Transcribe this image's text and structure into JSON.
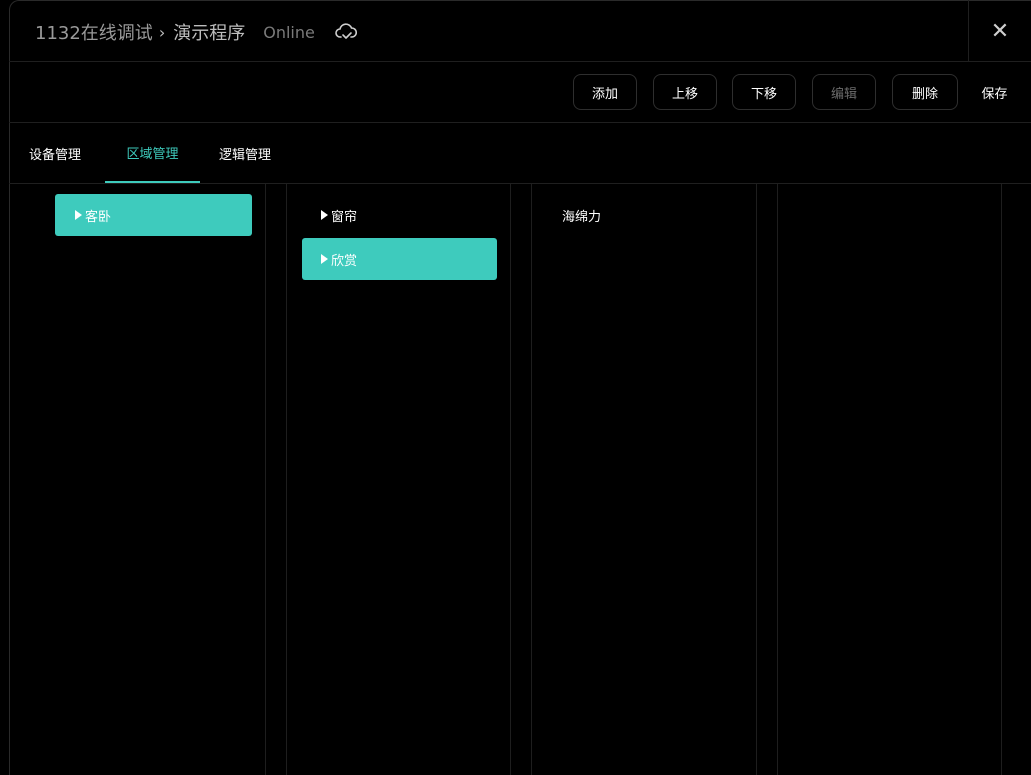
{
  "header": {
    "project": "1132在线调试",
    "page": "演示程序",
    "status": "Online"
  },
  "toolbar": {
    "add_label": "添加",
    "move_up_label": "上移",
    "move_down_label": "下移",
    "edit_label": "编辑",
    "delete_label": "删除",
    "save_label": "保存"
  },
  "tabs": [
    {
      "label": "设备管理",
      "active": false
    },
    {
      "label": "区域管理",
      "active": true
    },
    {
      "label": "逻辑管理",
      "active": false
    }
  ],
  "columns": {
    "col1": [
      {
        "label": "客卧",
        "selected": true
      }
    ],
    "col2": [
      {
        "label": "窗帘",
        "selected": false
      },
      {
        "label": "欣赏",
        "selected": true
      }
    ],
    "col3": [
      {
        "label": "海绵力",
        "selected": false
      }
    ]
  },
  "colors": {
    "accent": "#3ecbbd",
    "background": "#000000"
  },
  "icons": {
    "cloud": "cloud-check-icon",
    "close": "close-icon",
    "expand": "caret-right-icon"
  }
}
